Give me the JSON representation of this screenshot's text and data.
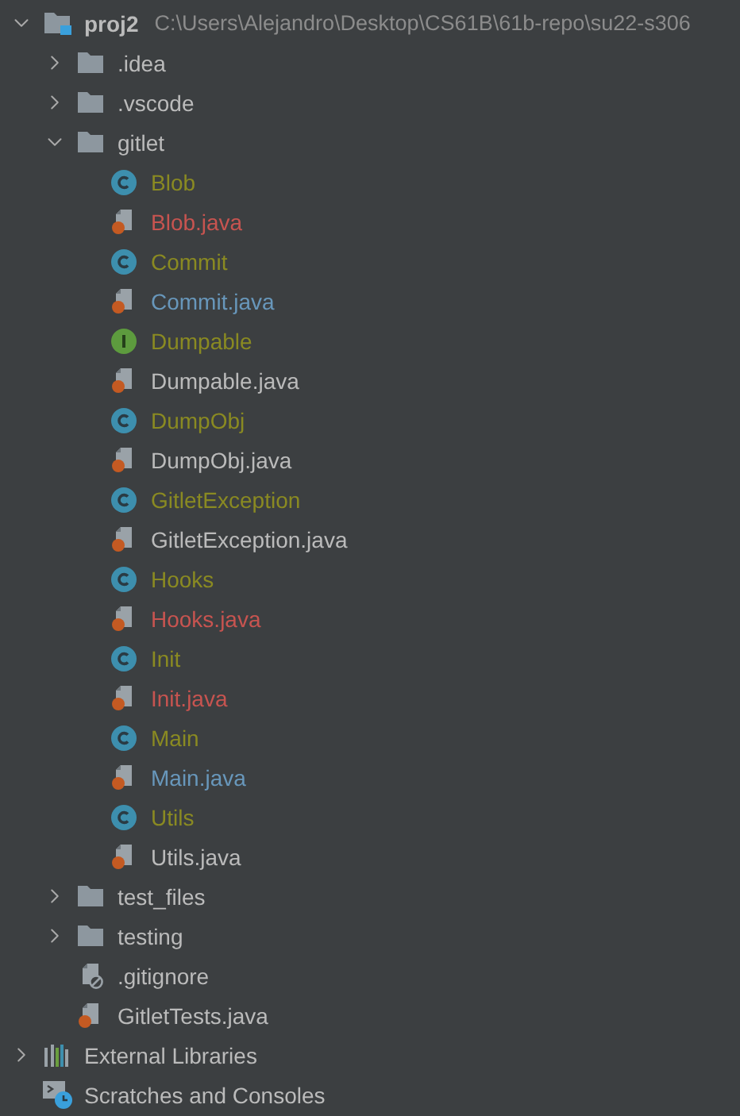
{
  "tree": [
    {
      "kind": "project",
      "label": "proj2",
      "path": "C:\\Users\\Alejandro\\Desktop\\CS61B\\61b-repo\\su22-s306",
      "expanded": true,
      "children": [
        {
          "kind": "folder",
          "label": ".idea",
          "expanded": false
        },
        {
          "kind": "folder",
          "label": ".vscode",
          "expanded": false
        },
        {
          "kind": "folder",
          "label": "gitlet",
          "expanded": true,
          "children": [
            {
              "kind": "class",
              "label": "Blob",
              "color": "#8a8a22"
            },
            {
              "kind": "java",
              "label": "Blob.java",
              "color": "#c75450"
            },
            {
              "kind": "class",
              "label": "Commit",
              "color": "#8a8a22"
            },
            {
              "kind": "java",
              "label": "Commit.java",
              "color": "#6897bb"
            },
            {
              "kind": "interface",
              "label": "Dumpable",
              "color": "#8a8a22"
            },
            {
              "kind": "java",
              "label": "Dumpable.java",
              "color": "#bbbbbb"
            },
            {
              "kind": "class",
              "label": "DumpObj",
              "color": "#8a8a22"
            },
            {
              "kind": "java",
              "label": "DumpObj.java",
              "color": "#bbbbbb"
            },
            {
              "kind": "class",
              "label": "GitletException",
              "color": "#8a8a22"
            },
            {
              "kind": "java",
              "label": "GitletException.java",
              "color": "#bbbbbb"
            },
            {
              "kind": "class",
              "label": "Hooks",
              "color": "#8a8a22"
            },
            {
              "kind": "java",
              "label": "Hooks.java",
              "color": "#c75450"
            },
            {
              "kind": "class",
              "label": "Init",
              "color": "#8a8a22"
            },
            {
              "kind": "java",
              "label": "Init.java",
              "color": "#c75450"
            },
            {
              "kind": "class",
              "label": "Main",
              "color": "#8a8a22"
            },
            {
              "kind": "java",
              "label": "Main.java",
              "color": "#6897bb"
            },
            {
              "kind": "class",
              "label": "Utils",
              "color": "#8a8a22"
            },
            {
              "kind": "java",
              "label": "Utils.java",
              "color": "#bbbbbb"
            }
          ]
        },
        {
          "kind": "folder",
          "label": "test_files",
          "expanded": false
        },
        {
          "kind": "folder",
          "label": "testing",
          "expanded": false
        },
        {
          "kind": "ignore",
          "label": ".gitignore",
          "color": "#bbbbbb"
        },
        {
          "kind": "java",
          "label": "GitletTests.java",
          "color": "#bbbbbb"
        }
      ]
    },
    {
      "kind": "libraries",
      "label": "External Libraries",
      "expanded": false
    },
    {
      "kind": "scratches",
      "label": "Scratches and Consoles"
    }
  ]
}
